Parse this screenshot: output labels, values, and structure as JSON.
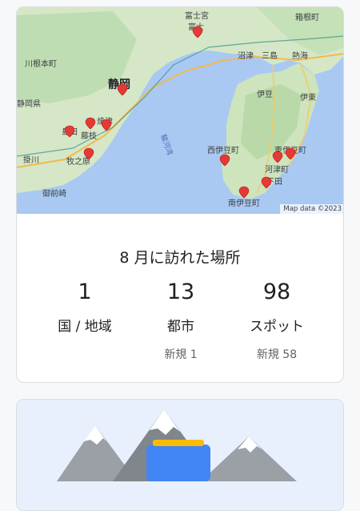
{
  "summary": {
    "map": {
      "attribution": "Map data ©2023",
      "labels": {
        "fujinomiya": "富士宮",
        "fuji": "富士",
        "hakone": "箱根町",
        "kawanemoto": "川根本町",
        "shizuoka": "静岡",
        "numazu": "沼津",
        "mishima": "三島",
        "atami": "熱海",
        "shizuoka_pref": "静岡県",
        "izu": "伊豆",
        "ito": "伊東",
        "shimada": "島田",
        "yaizu": "焼津",
        "fujieda": "藤枝",
        "suruga_bay": "駿河湾",
        "nishiizu": "西伊豆町",
        "higashiizu": "東伊豆町",
        "kakegawa": "掛川",
        "makinohara": "牧之原",
        "kawazu": "河津町",
        "shimoda": "下田",
        "omaezaki": "御前崎",
        "minamiizu": "南伊豆町"
      }
    },
    "title": "8 月に訪れた場所",
    "stats": [
      {
        "value": "1",
        "label": "国 / 地域",
        "sub": ""
      },
      {
        "value": "13",
        "label": "都市",
        "sub": "新規 1"
      },
      {
        "value": "98",
        "label": "スポット",
        "sub": "新規 58"
      }
    ]
  },
  "colors": {
    "sea": "#a7c8f2",
    "land": "#d4e8c8",
    "pin": "#e53935",
    "road": "#f9c74f"
  }
}
